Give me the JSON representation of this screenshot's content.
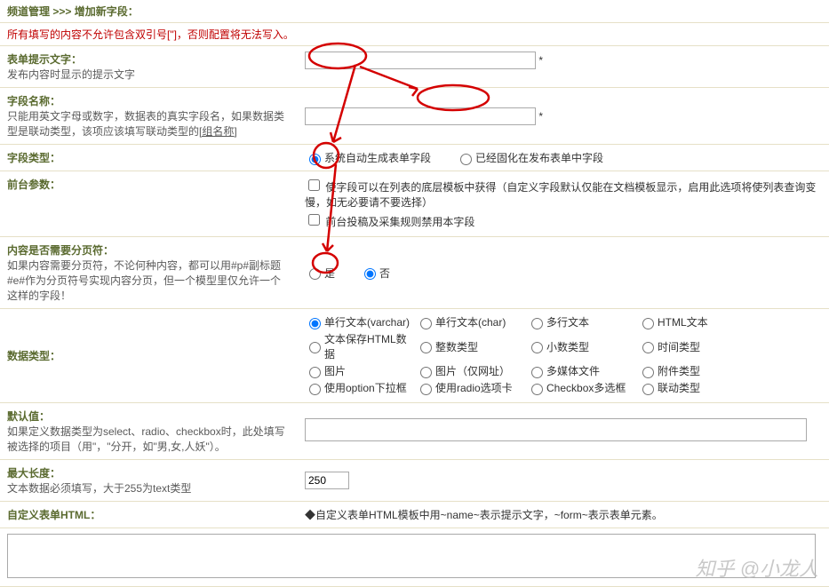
{
  "breadcrumb": {
    "section": "频道管理",
    "separator": ">>>",
    "current": "增加新字段："
  },
  "warning_text": "所有填写的内容不允许包含双引号[\"]，否则配置将无法写入。",
  "rows": {
    "prompt": {
      "title": "表单提示文字：",
      "desc": "发布内容时显示的提示文字",
      "value": "",
      "after": "*"
    },
    "field_name": {
      "title": "字段名称：",
      "desc": "只能用英文字母或数字，数据表的真实字段名，如果数据类型是联动类型，该项应该填写联动类型的[组名称]",
      "value": "",
      "after": "*"
    },
    "field_type": {
      "title": "字段类型：",
      "options": {
        "auto": "系统自动生成表单字段",
        "fixed": "已经固化在发布表单中字段"
      },
      "selected": "auto"
    },
    "front_param": {
      "title": "前台参数：",
      "opt1": "使字段可以在列表的底层模板中获得（自定义字段默认仅能在文档模板显示，启用此选项将使列表查询变慢，如无必要请不要选择）",
      "opt2": "前台投稿及采集规则禁用本字段"
    },
    "pagebreak": {
      "title": "内容是否需要分页符：",
      "desc": "如果内容需要分页符，不论何种内容，都可以用#p#副标题#e#作为分页符号实现内容分页，但一个模型里仅允许一个这样的字段！",
      "yes": "是",
      "no": "否",
      "selected": "no"
    },
    "data_type": {
      "title": "数据类型：",
      "options": {
        "varchar": "单行文本(varchar)",
        "char": "单行文本(char)",
        "multiline": "多行文本",
        "html": "HTML文本",
        "html_data": "文本保存HTML数据",
        "integer": "整数类型",
        "decimal": "小数类型",
        "time": "时间类型",
        "image": "图片",
        "image_url": "图片（仅网址）",
        "media": "多媒体文件",
        "attachment": "附件类型",
        "option": "使用option下拉框",
        "radio": "使用radio选项卡",
        "checkbox": "Checkbox多选框",
        "linkage": "联动类型"
      },
      "selected": "varchar"
    },
    "default_value": {
      "title": "默认值：",
      "desc": "如果定义数据类型为select、radio、checkbox时，此处填写被选择的项目（用\"，\"分开，如\"男,女,人妖\"）。",
      "value": ""
    },
    "max_length": {
      "title": "最大长度：",
      "desc": "文本数据必须填写，大于255为text类型",
      "value": "250"
    },
    "custom_html": {
      "title": "自定义表单HTML：",
      "note": "◆自定义表单HTML模板中用~name~表示提示文字，~form~表示表单元素。",
      "value": ""
    }
  },
  "watermark": "知乎 @小龙人"
}
